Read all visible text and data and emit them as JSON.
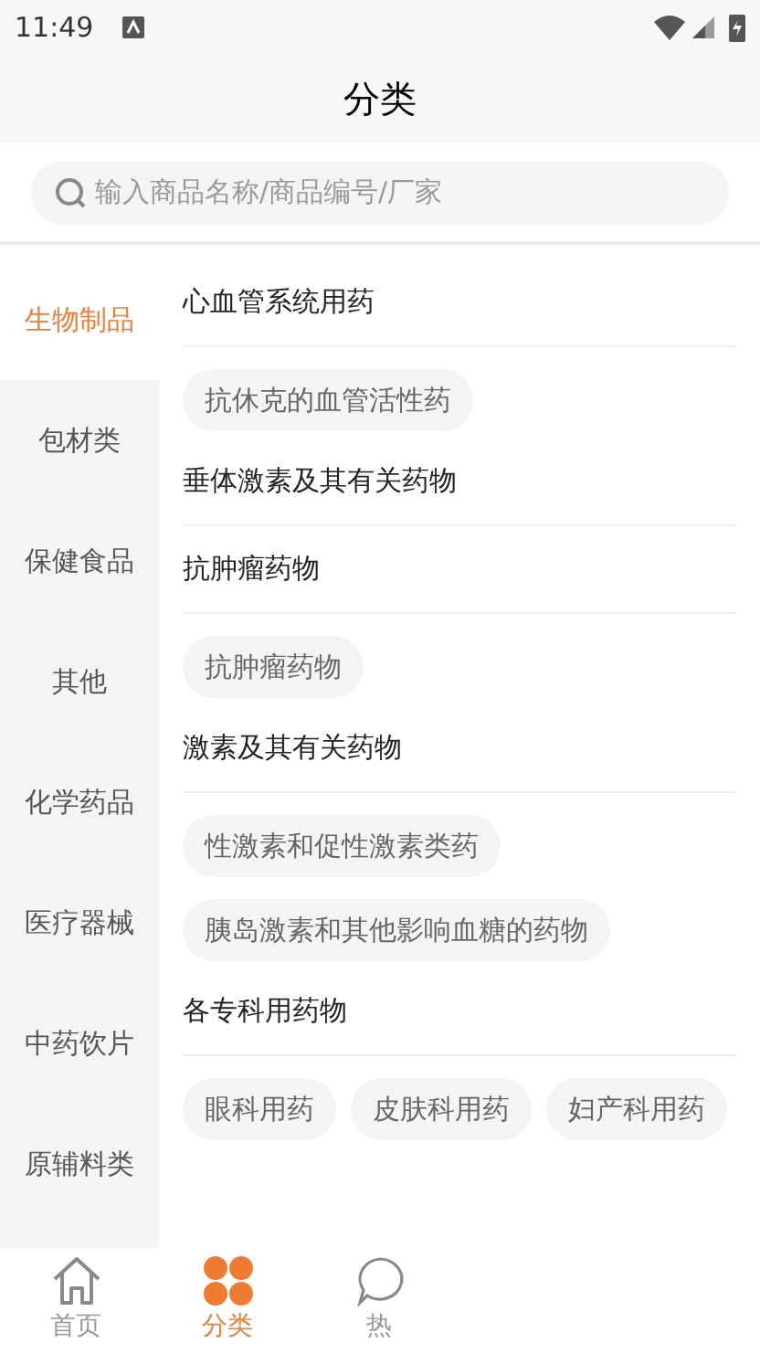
{
  "status_bar": {
    "time": "11:49"
  },
  "header": {
    "title": "分类"
  },
  "search": {
    "placeholder": "输入商品名称/商品编号/厂家"
  },
  "sidebar": {
    "items": [
      {
        "label": "生物制品",
        "selected": true
      },
      {
        "label": "包材类",
        "selected": false
      },
      {
        "label": "保健食品",
        "selected": false
      },
      {
        "label": "其他",
        "selected": false
      },
      {
        "label": "化学药品",
        "selected": false
      },
      {
        "label": "医疗器械",
        "selected": false
      },
      {
        "label": "中药饮片",
        "selected": false
      },
      {
        "label": "原辅料类",
        "selected": false
      }
    ]
  },
  "groups": [
    {
      "title": "心血管系统用药",
      "chips": [
        "抗休克的血管活性药"
      ]
    },
    {
      "title": "垂体激素及其有关药物"
    },
    {
      "title": "抗肿瘤药物",
      "chips": [
        "抗肿瘤药物"
      ]
    },
    {
      "title": "激素及其有关药物",
      "chips": [
        "性激素和促性激素类药",
        "胰岛激素和其他影响血糖的药物"
      ]
    },
    {
      "title": "各专科用药物",
      "chips": [
        "眼科用药",
        "皮肤科用药",
        "妇产科用药"
      ]
    }
  ],
  "bottom_nav": [
    {
      "kind": "home",
      "label": "首页",
      "selected": false
    },
    {
      "kind": "grid",
      "label": "分类",
      "selected": true
    },
    {
      "kind": "hot",
      "label": "热",
      "selected": false
    }
  ]
}
